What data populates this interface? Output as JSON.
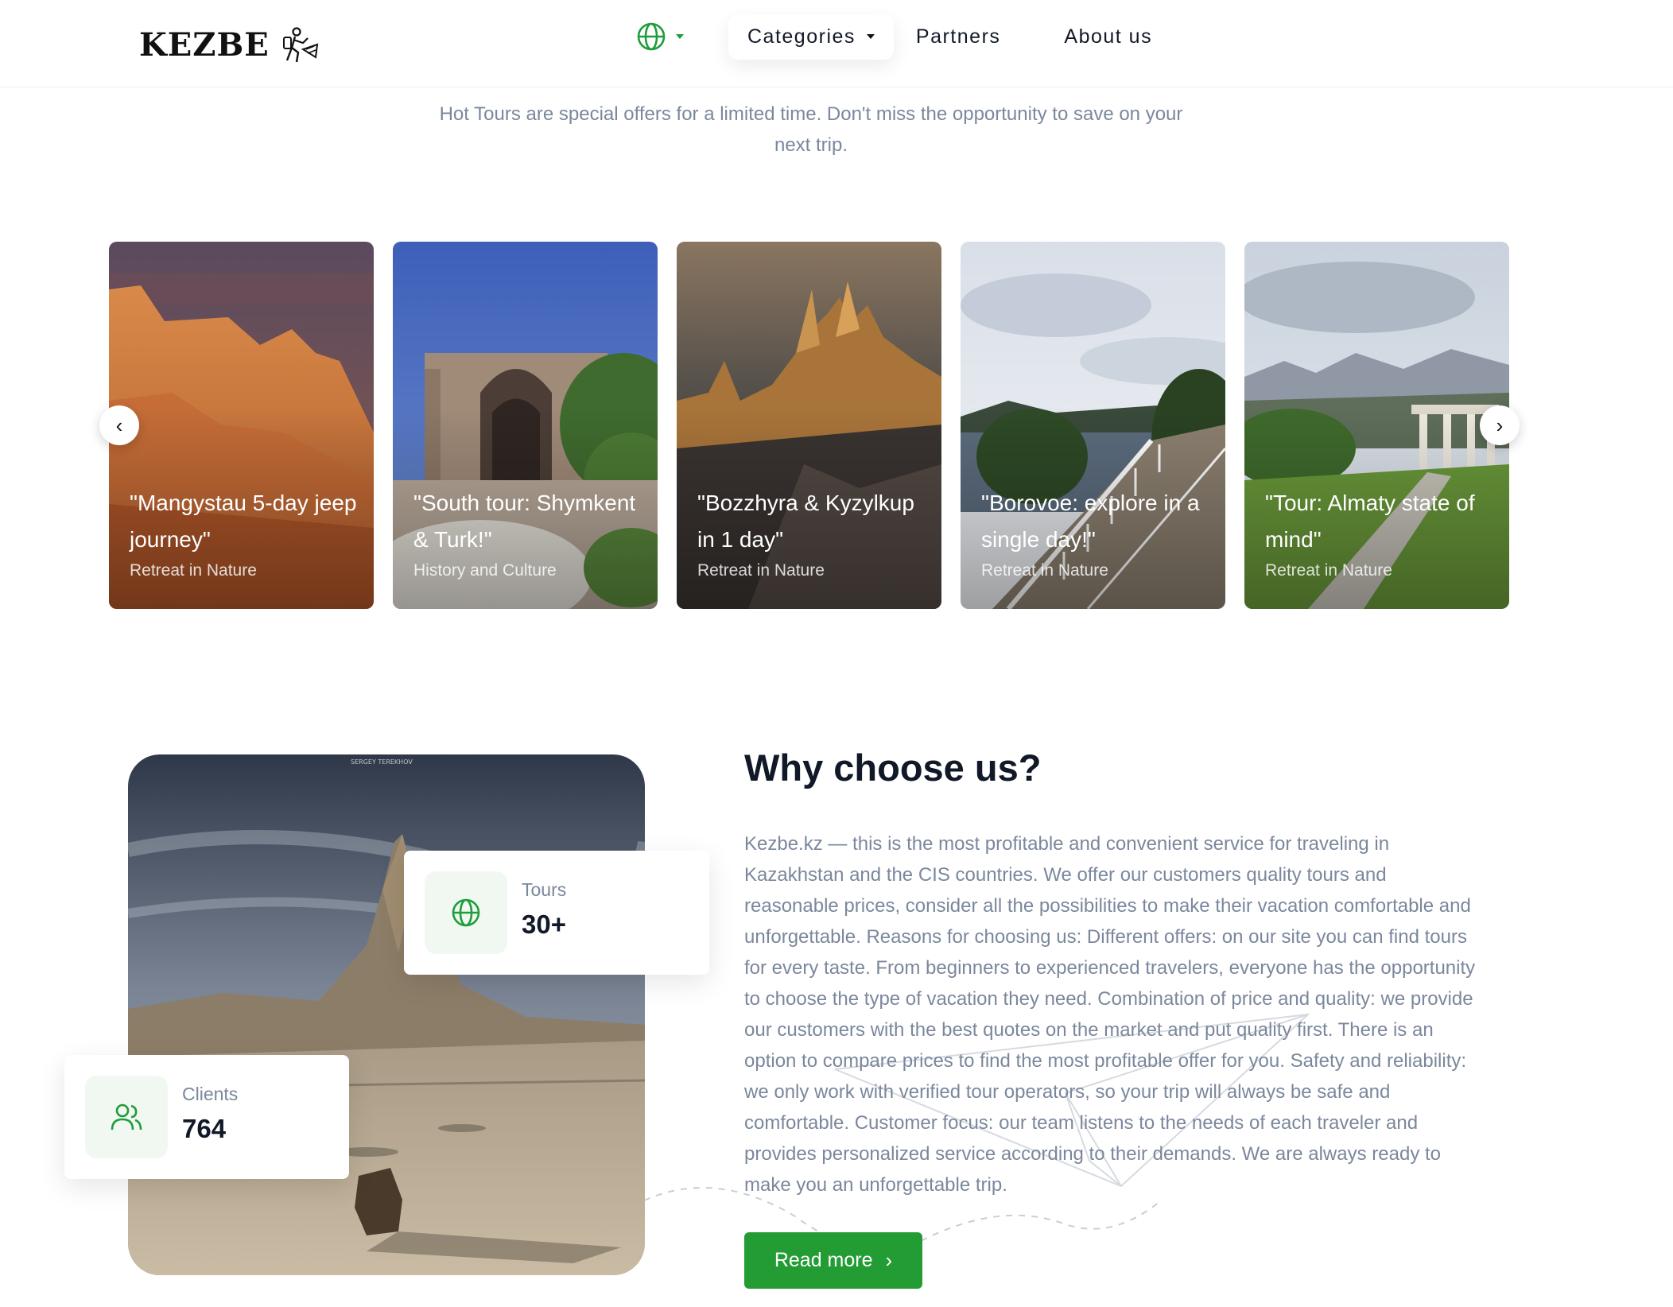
{
  "header": {
    "logo_text": "KEZBE",
    "nav": {
      "language_icon": "globe-icon",
      "categories": "Categories",
      "partners": "Partners",
      "about": "About us"
    }
  },
  "intro": {
    "text": "Hot Tours are special offers for a limited time. Don't miss the opportunity to save on your next trip."
  },
  "tours": [
    {
      "title": "\"Mangystau 5-day jeep journey\"",
      "category": "Retreat in Nature"
    },
    {
      "title": "\"South tour: Shymkent & Turk!\"",
      "category": "History and Culture"
    },
    {
      "title": "\"Bozzhyra & Kyzylkup in 1 day\"",
      "category": "Retreat in Nature"
    },
    {
      "title": "\"Borovoe: explore in a single day!\"",
      "category": "Retreat in Nature"
    },
    {
      "title": "\"Tour: Almaty state of mind\"",
      "category": "Retreat in Nature"
    }
  ],
  "carousel": {
    "prev_icon": "chevron-left-icon",
    "next_icon": "chevron-right-icon"
  },
  "why": {
    "title": "Why choose us?",
    "text": "Kezbe.kz — this is the most profitable and convenient service for traveling in Kazakhstan and the CIS countries. We offer our customers quality tours and reasonable prices, consider all the possibilities to make their vacation comfortable and unforgettable. Reasons for choosing us: Different offers: on our site you can find tours for every taste. From beginners to experienced travelers, everyone has the opportunity to choose the type of vacation they need. Combination of price and quality: we provide our customers with the best quotes on the market and put quality first. There is an option to compare prices to find the most profitable offer for you. Safety and reliability: we only work with verified tour operators, so your trip will always be safe and comfortable. Customer focus: our team listens to the needs of each traveler and provides personalized service according to their demands. We are always ready to make you an unforgettable trip.",
    "read_more": "Read more",
    "stats": {
      "tours_label": "Tours",
      "tours_value": "30+",
      "clients_label": "Clients",
      "clients_value": "764"
    },
    "photo_credit": "SERGEY TEREKHOV"
  },
  "colors": {
    "accent": "#229c33",
    "muted_text": "#7b879c",
    "heading": "#111827"
  }
}
